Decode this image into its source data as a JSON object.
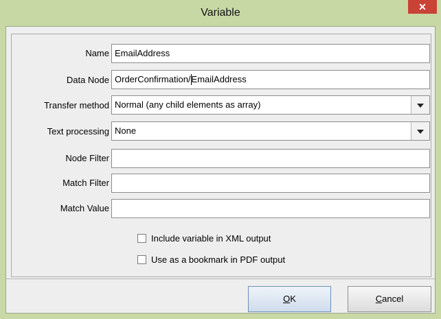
{
  "window": {
    "title": "Variable",
    "close_glyph": "✕"
  },
  "form": {
    "name": {
      "label": "Name",
      "value": "EmailAddress"
    },
    "data_node": {
      "label": "Data Node",
      "value_before_caret": "OrderConfirmation/",
      "value_after_caret": "EmailAddress"
    },
    "transfer_method": {
      "label": "Transfer method",
      "value": "Normal (any child elements as array)"
    },
    "text_processing": {
      "label": "Text processing",
      "value": "None"
    },
    "node_filter": {
      "label": "Node Filter",
      "value": ""
    },
    "match_filter": {
      "label": "Match Filter",
      "value": ""
    },
    "match_value": {
      "label": "Match Value",
      "value": ""
    },
    "include_xml": {
      "label": "Include variable in XML output",
      "checked": false
    },
    "bookmark_pdf": {
      "label": "Use as a bookmark in PDF output",
      "checked": false
    }
  },
  "buttons": {
    "ok": {
      "mnemonic": "O",
      "rest": "K"
    },
    "cancel": {
      "mnemonic": "C",
      "rest": "ancel"
    }
  },
  "colors": {
    "titlebar": "#c8d8a4",
    "close": "#c94236",
    "dialog_bg": "#eeeeee"
  },
  "icons": {
    "close": "close-icon",
    "dropdown": "chevron-down-icon"
  }
}
